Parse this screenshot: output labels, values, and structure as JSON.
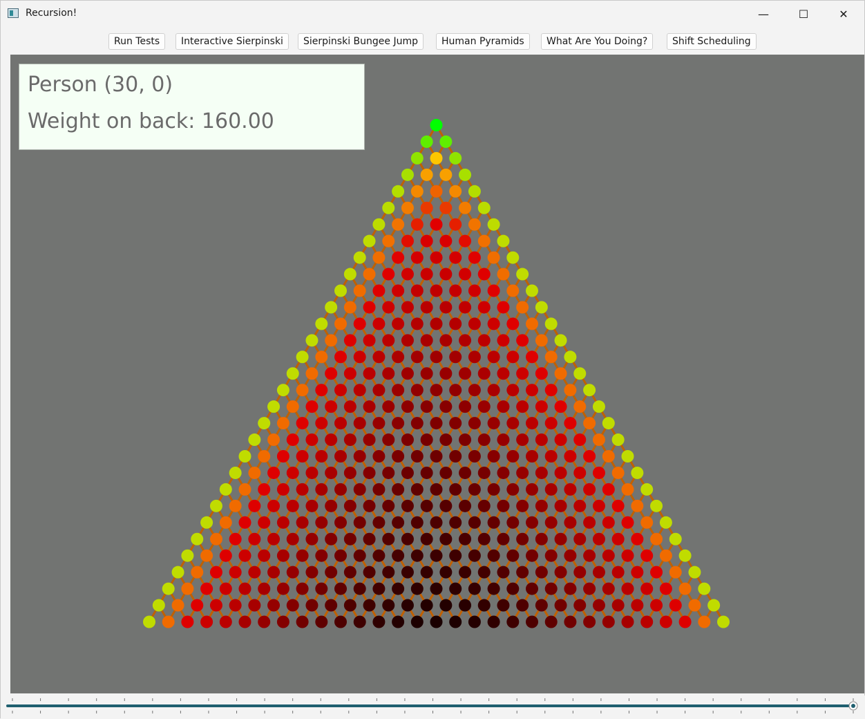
{
  "window": {
    "title": "Recursion!",
    "minimize_glyph": "—",
    "maximize_glyph": "☐",
    "close_glyph": "✕",
    "app_icon": "app-icon"
  },
  "toolbar": {
    "buttons": [
      {
        "label": "Run Tests"
      },
      {
        "label": "Interactive Sierpinski"
      },
      {
        "label": "Sierpinski Bungee Jump"
      },
      {
        "label": "Human Pyramids"
      },
      {
        "label": "What Are You Doing?"
      },
      {
        "label": "Shift Scheduling"
      }
    ]
  },
  "info": {
    "person": "Person (30, 0)",
    "weight": "Weight on back: 160.00"
  },
  "pyramid": {
    "rows": 31,
    "node_color_scale": [
      "#00ff00",
      "#ffd000",
      "#e00000",
      "#1a0000"
    ],
    "edge_color": "#c06000"
  },
  "slider": {
    "value_fraction": 1.0,
    "track_color": "#1f5f6f"
  }
}
